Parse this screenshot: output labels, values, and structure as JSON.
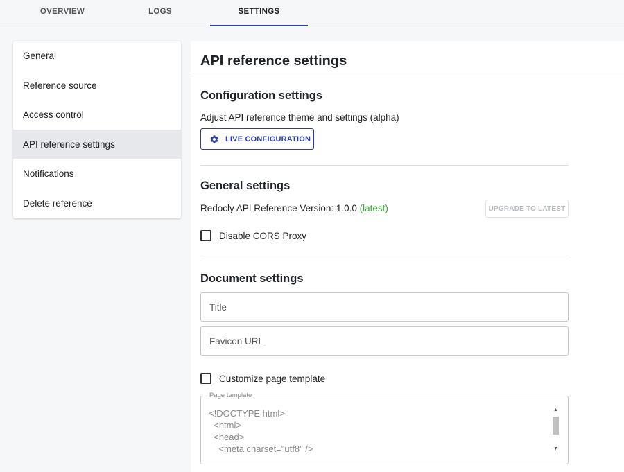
{
  "tabs": [
    {
      "label": "OVERVIEW"
    },
    {
      "label": "LOGS"
    },
    {
      "label": "SETTINGS",
      "active": true
    }
  ],
  "sidebar": {
    "items": [
      {
        "label": "General"
      },
      {
        "label": "Reference source"
      },
      {
        "label": "Access control"
      },
      {
        "label": "API reference settings",
        "active": true
      },
      {
        "label": "Notifications"
      },
      {
        "label": "Delete reference"
      }
    ]
  },
  "main": {
    "title": "API reference settings",
    "configuration": {
      "heading": "Configuration settings",
      "description": "Adjust API reference theme and settings (alpha)",
      "live_button_label": "LIVE CONFIGURATION",
      "live_button_icon": "gear-icon"
    },
    "general": {
      "heading": "General settings",
      "version_label": "Redocly API Reference Version: 1.0.0",
      "version_status": "(latest)",
      "upgrade_button_label": "UPGRADE TO LATEST",
      "cors_label": "Disable CORS Proxy",
      "cors_checked": false
    },
    "document": {
      "heading": "Document settings",
      "title_placeholder": "Title",
      "favicon_placeholder": "Favicon URL",
      "customize_label": "Customize page template",
      "customize_checked": false,
      "template_legend": "Page template",
      "template_lines": [
        "<!DOCTYPE html>",
        "  <html>",
        "  <head>",
        "    <meta charset=\"utf8\" />"
      ]
    }
  },
  "colors": {
    "accent": "#2b3ea8",
    "latest": "#3aaa35",
    "active_sidebar_bg": "#e6e8eb"
  }
}
